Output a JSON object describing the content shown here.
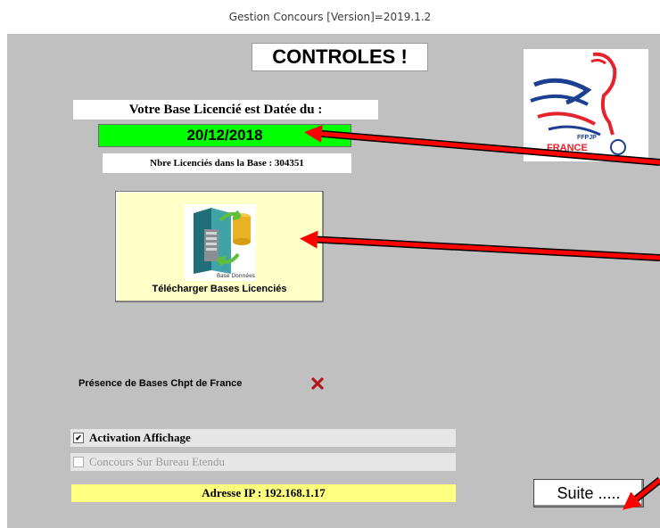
{
  "window": {
    "title": "Gestion Concours [Version]=2019.1.2"
  },
  "heading": "CONTROLES !",
  "database": {
    "date_label": "Votre Base Licencié est Datée du :",
    "date_value": "20/12/2018",
    "count_text": "Nbre Licenciés dans la Base : 304351",
    "date_color": "#00ff00"
  },
  "download_button": {
    "label": "Télécharger Bases Licenciés",
    "icon_caption": "Base Données",
    "background": "#ffffc8"
  },
  "logo": {
    "text_top": "FFPJP",
    "text_main": "FRANCE"
  },
  "chpt_presence": {
    "label": "Présence de Bases Chpt de France",
    "status_icon": "red-x-icon"
  },
  "options": {
    "activation": {
      "label": "Activation Affichage",
      "checked": true
    },
    "extended": {
      "label": "Concours Sur Bureau Etendu",
      "checked": false,
      "enabled": false
    }
  },
  "ip": {
    "text": "Adresse IP : 192.168.1.17",
    "background": "#ffff80"
  },
  "next_button": {
    "label": "Suite ....."
  },
  "annotation_color": "#ff0000"
}
